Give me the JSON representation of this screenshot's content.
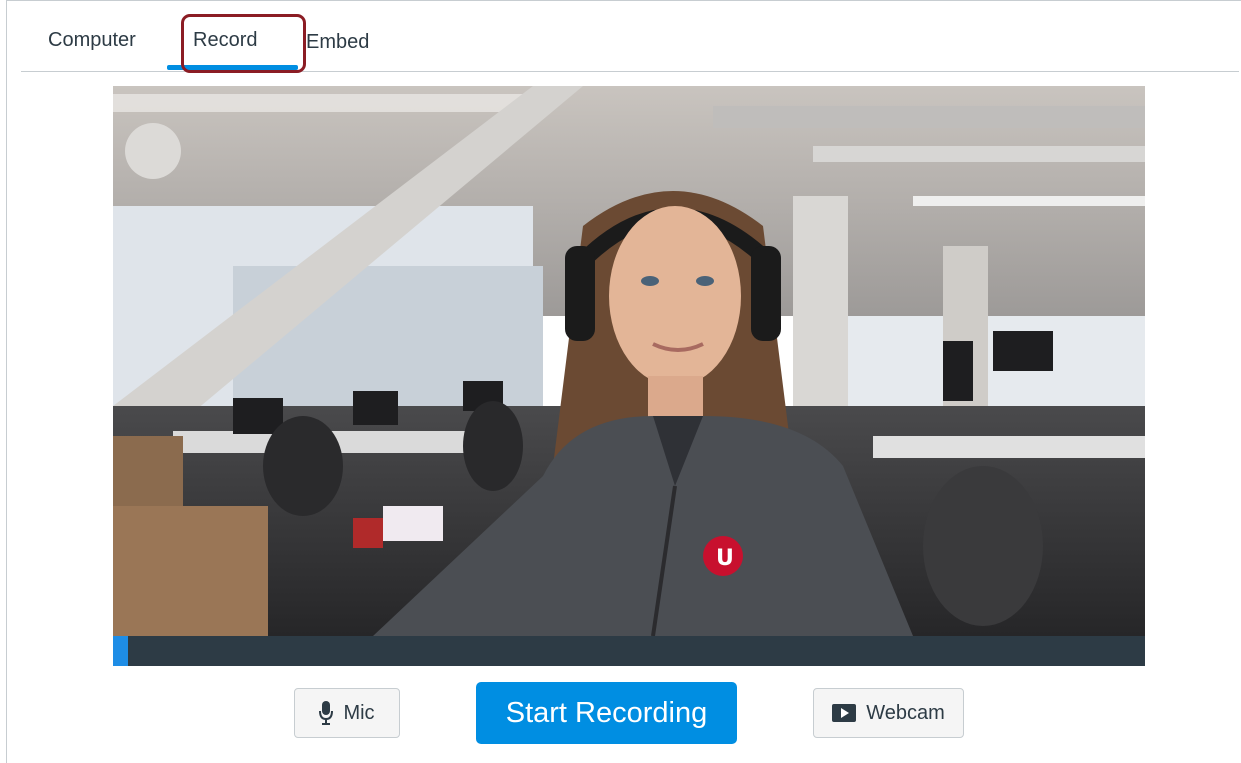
{
  "tabs": [
    {
      "label": "Computer",
      "active": false
    },
    {
      "label": "Record",
      "active": true
    },
    {
      "label": "Embed",
      "active": false
    }
  ],
  "colors": {
    "accent": "#008ee2",
    "highlight_outline": "#8b1c24",
    "text": "#2d3b45",
    "progress_track": "#2d3b45"
  },
  "video": {
    "content": "webcam-preview",
    "progress": 0.015
  },
  "controls": {
    "mic_label": "Mic",
    "mic_icon": "microphone-icon",
    "start_label": "Start Recording",
    "webcam_label": "Webcam",
    "webcam_icon": "video-play-icon"
  }
}
